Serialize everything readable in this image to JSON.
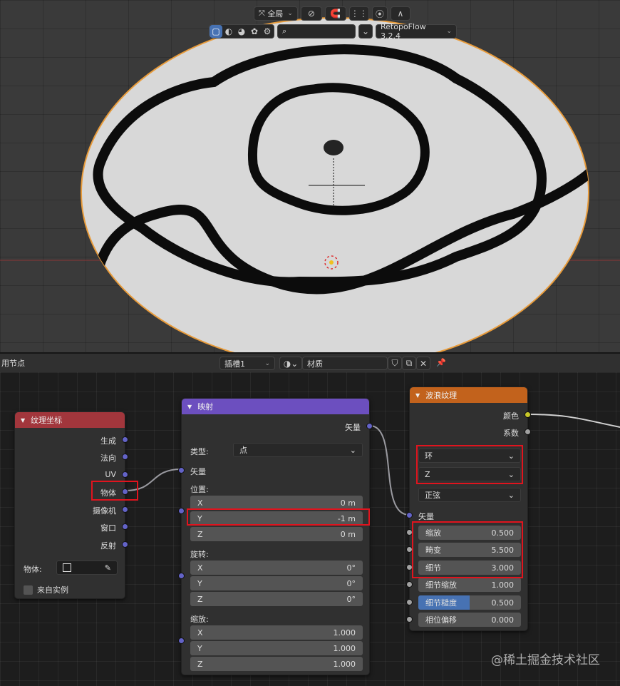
{
  "viewport": {
    "transform_orientation": "全局",
    "addon_name": "RetopoFlow 3.2.4"
  },
  "node_editor": {
    "header": {
      "use_nodes_label": "用节点",
      "slot": "插槽1",
      "material_name": "材质"
    },
    "tex_coord_node": {
      "title": "纹理坐标",
      "header_color": "#a2363c",
      "outputs": [
        "生成",
        "法向",
        "UV",
        "物体",
        "摄像机",
        "窗口",
        "反射"
      ],
      "object_label": "物体:",
      "from_instancer_label": "来自实例"
    },
    "mapping_node": {
      "title": "映射",
      "header_color": "#6c4fbf",
      "output_vector": "矢量",
      "type_label": "类型:",
      "type_value": "点",
      "input_vector": "矢量",
      "location_label": "位置:",
      "location": [
        {
          "axis": "X",
          "value": "0 m"
        },
        {
          "axis": "Y",
          "value": "-1 m"
        },
        {
          "axis": "Z",
          "value": "0 m"
        }
      ],
      "rotation_label": "旋转:",
      "rotation": [
        {
          "axis": "X",
          "value": "0°"
        },
        {
          "axis": "Y",
          "value": "0°"
        },
        {
          "axis": "Z",
          "value": "0°"
        }
      ],
      "scale_label": "缩放:",
      "scale": [
        {
          "axis": "X",
          "value": "1.000"
        },
        {
          "axis": "Y",
          "value": "1.000"
        },
        {
          "axis": "Z",
          "value": "1.000"
        }
      ]
    },
    "wave_node": {
      "title": "波浪纹理",
      "header_color": "#c2621c",
      "output_color": "颜色",
      "output_fac": "系数",
      "wave_type": "环",
      "direction": "Z",
      "profile": "正弦",
      "input_vector": "矢量",
      "params": [
        {
          "label": "缩放",
          "value": "0.500"
        },
        {
          "label": "畸变",
          "value": "5.500"
        },
        {
          "label": "细节",
          "value": "3.000"
        },
        {
          "label": "细节缩放",
          "value": "1.000"
        },
        {
          "label": "细节糙度",
          "value": "0.500"
        },
        {
          "label": "相位偏移",
          "value": "0.000"
        }
      ],
      "detail_roughness_fill": 0.5
    }
  },
  "watermark": "@稀土掘金技术社区"
}
